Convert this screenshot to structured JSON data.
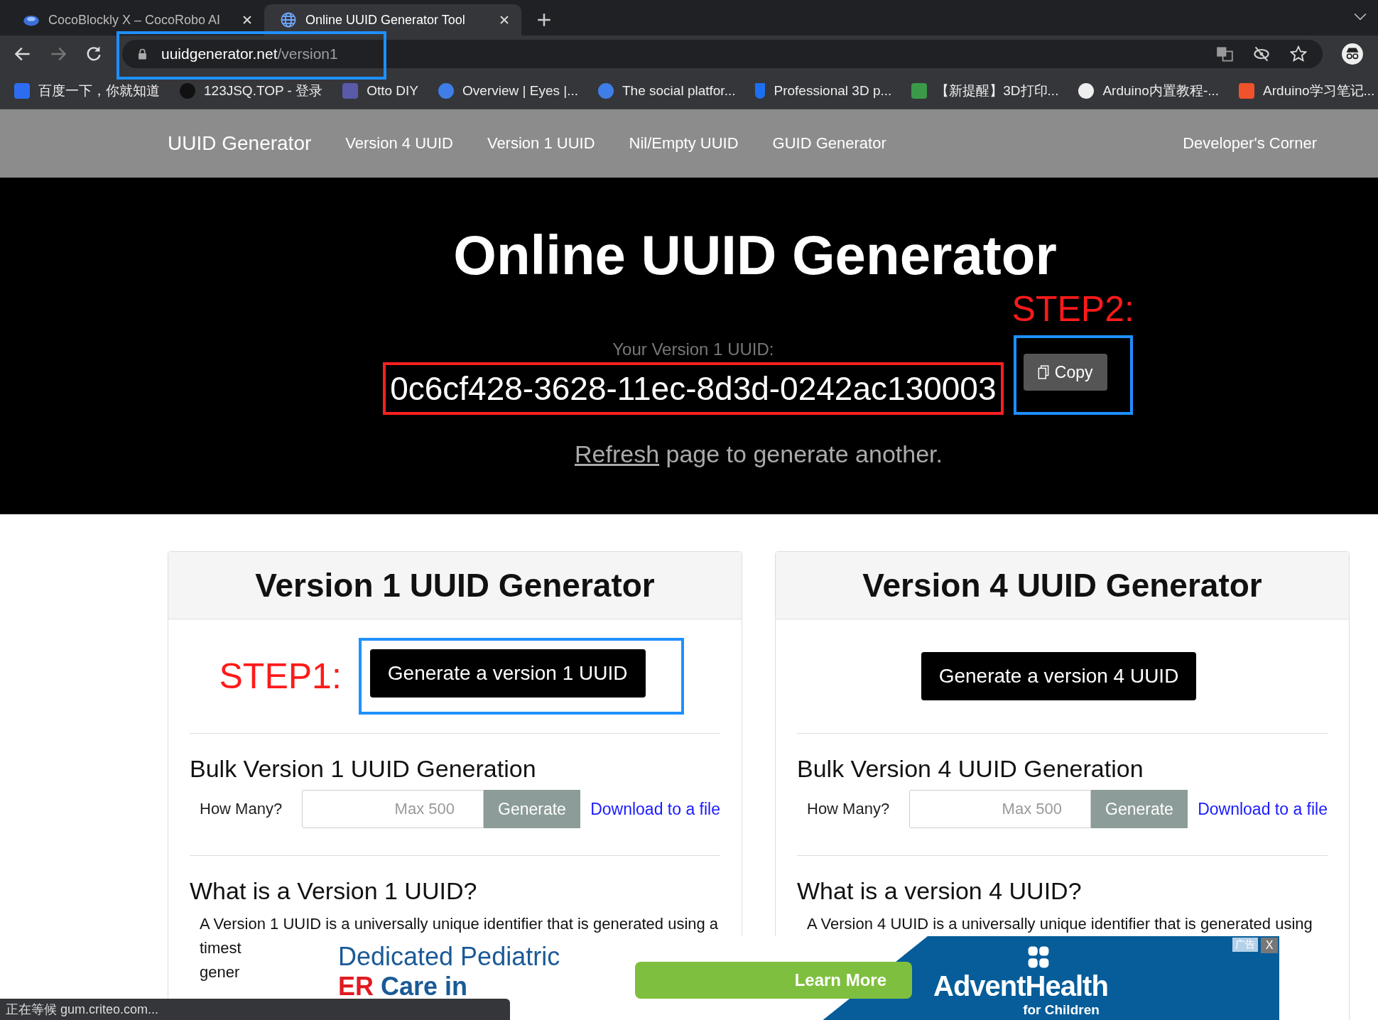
{
  "browser": {
    "tabs": [
      {
        "title": "CocoBlockly X – CocoRobo AI",
        "selected": false
      },
      {
        "title": "Online UUID Generator Tool",
        "selected": true
      }
    ],
    "address": {
      "host": "uuidgenerator.net",
      "path": "/version1"
    },
    "bookmarks": [
      "百度一下，你就知道",
      "123JSQ.TOP - 登录",
      "Otto DIY",
      "Overview | Eyes |...",
      "The social platfor...",
      "Professional 3D p...",
      "【新提醒】3D打印...",
      "Arduino内置教程-...",
      "Arduino学习笔记..."
    ]
  },
  "nav": {
    "brand": "UUID Generator",
    "links": [
      "Version 4 UUID",
      "Version 1 UUID",
      "Nil/Empty UUID",
      "GUID Generator"
    ],
    "right_link": "Developer's Corner"
  },
  "hero": {
    "title": "Online UUID Generator",
    "step_note": "STEP2:",
    "uuid_label": "Your Version 1 UUID:",
    "uuid": "0c6cf428-3628-11ec-8d3d-0242ac130003",
    "copy_button": "Copy",
    "refresh_link": "Refresh",
    "refresh_rest": "page to generate another."
  },
  "cards": [
    {
      "title": "Version 1 UUID Generator",
      "step_note": "STEP1:",
      "button": "Generate a version 1 UUID",
      "bulk_title": "Bulk Version 1 UUID Generation",
      "how_many": "How Many?",
      "placeholder": "Max 500",
      "generate": "Generate",
      "download": "Download to a file",
      "what_title": "What is a Version 1 UUID?",
      "lines": [
        "A Version 1 UUID is a universally unique identifier that is generated using a",
        "timest",
        "gener"
      ]
    },
    {
      "title": "Version 4 UUID Generator",
      "button": "Generate a version 4 UUID",
      "bulk_title": "Bulk Version 4 UUID Generation",
      "how_many": "How Many?",
      "placeholder": "Max 500",
      "generate": "Generate",
      "download": "Download to a file",
      "what_title": "What is a version 4 UUID?",
      "lines": [
        "A Version 4 UUID is a universally unique identifier that is generated using"
      ]
    }
  ],
  "ad": {
    "headline": "Dedicated Pediatric",
    "highlight": "ER",
    "subline": "Care in",
    "button": "Learn More",
    "brand": "AdventHealth",
    "brand_sub": "for Children",
    "tag": "广告",
    "close": "X"
  },
  "status_bar": "正在等候 gum.criteo.com..."
}
